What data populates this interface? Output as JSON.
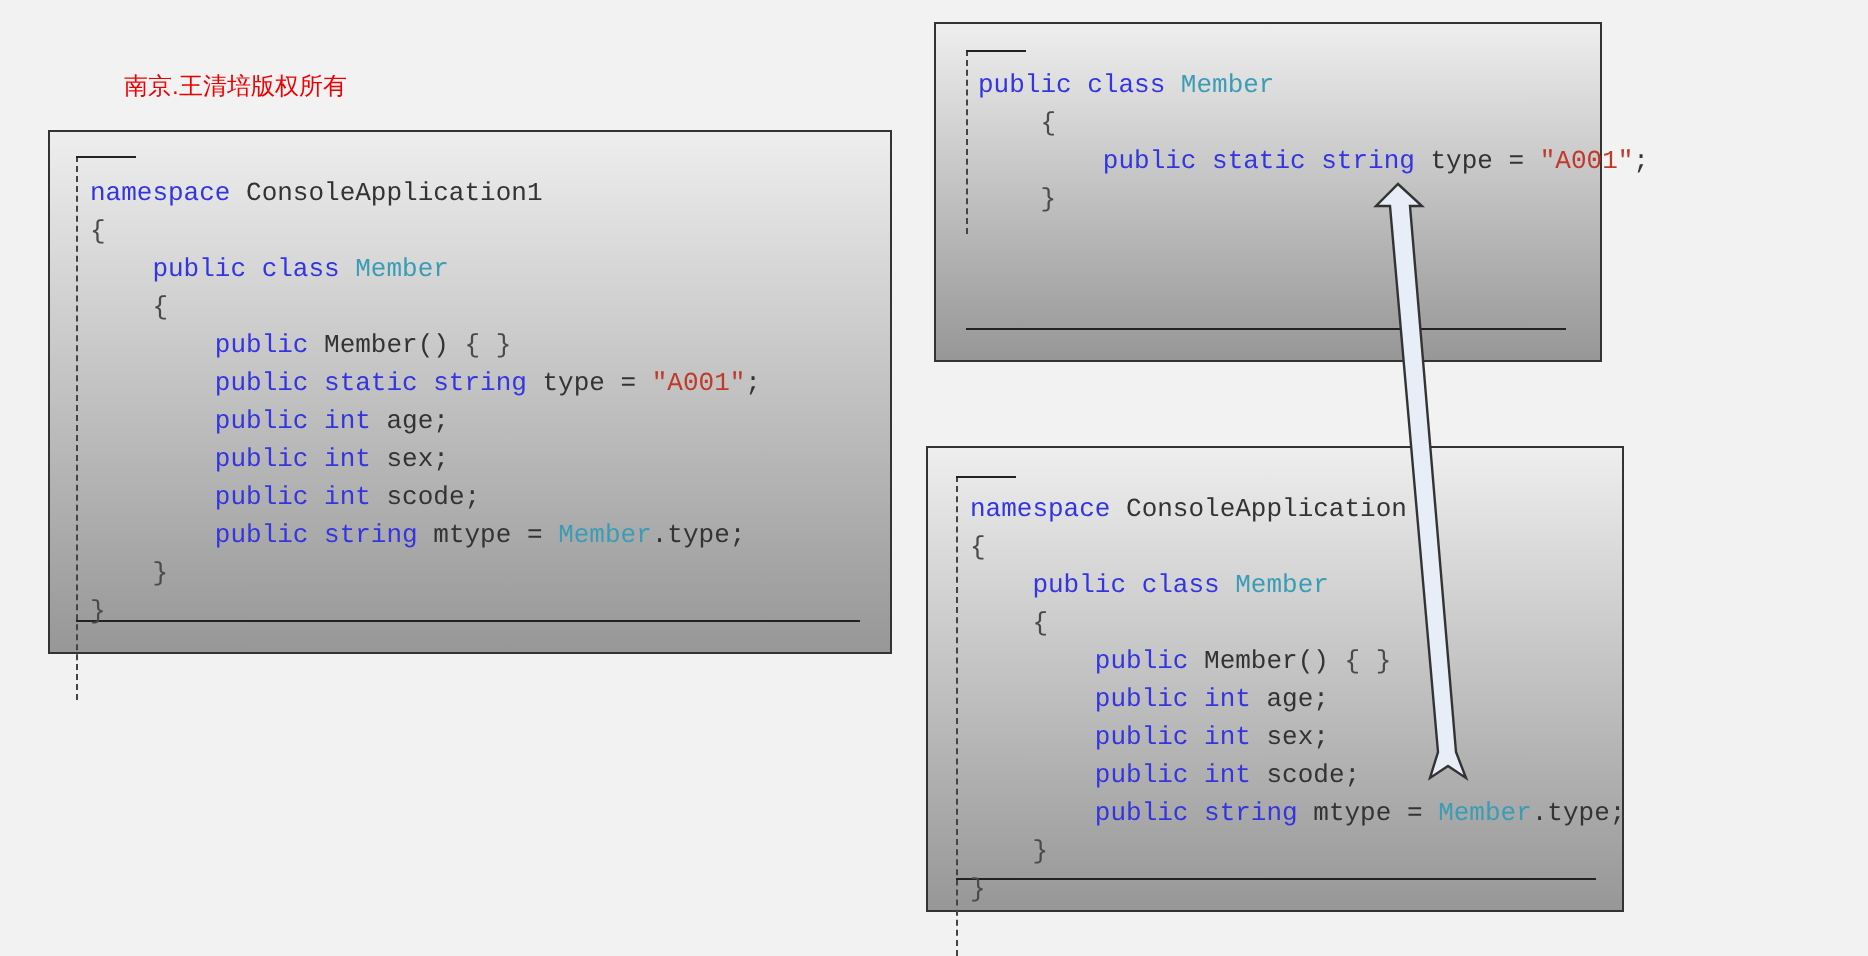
{
  "copyright": "南京.王清培版权所有",
  "panels": [
    {
      "lines": [
        [
          {
            "kind": "keyword",
            "text": "namespace "
          },
          {
            "kind": "plain",
            "text": "ConsoleApplication1"
          }
        ],
        [
          {
            "kind": "punct",
            "text": "{"
          }
        ],
        [
          {
            "kind": "keyword",
            "text": "    public class "
          },
          {
            "kind": "type",
            "text": "Member"
          }
        ],
        [
          {
            "kind": "punct",
            "text": "    {"
          }
        ],
        [
          {
            "kind": "keyword",
            "text": "        public "
          },
          {
            "kind": "plain",
            "text": "Member() "
          },
          {
            "kind": "punct",
            "text": "{ }"
          }
        ],
        [
          {
            "kind": "keyword",
            "text": "        public static string "
          },
          {
            "kind": "plain",
            "text": "type = "
          },
          {
            "kind": "string",
            "text": "\"A001\""
          },
          {
            "kind": "plain",
            "text": ";"
          }
        ],
        [
          {
            "kind": "keyword",
            "text": "        public int "
          },
          {
            "kind": "plain",
            "text": "age;"
          }
        ],
        [
          {
            "kind": "keyword",
            "text": "        public int "
          },
          {
            "kind": "plain",
            "text": "sex;"
          }
        ],
        [
          {
            "kind": "keyword",
            "text": "        public int "
          },
          {
            "kind": "plain",
            "text": "scode;"
          }
        ],
        [
          {
            "kind": "keyword",
            "text": "        public string "
          },
          {
            "kind": "plain",
            "text": "mtype = "
          },
          {
            "kind": "type",
            "text": "Member"
          },
          {
            "kind": "plain",
            "text": ".type;"
          }
        ],
        [
          {
            "kind": "punct",
            "text": "    }"
          }
        ],
        [
          {
            "kind": "punct",
            "text": "}"
          }
        ]
      ]
    },
    {
      "lines": [
        [
          {
            "kind": "keyword",
            "text": "public class "
          },
          {
            "kind": "type",
            "text": "Member"
          }
        ],
        [
          {
            "kind": "punct",
            "text": "    {"
          }
        ],
        [
          {
            "kind": "keyword",
            "text": "        public static string "
          },
          {
            "kind": "plain",
            "text": "type = "
          },
          {
            "kind": "string",
            "text": "\"A001\""
          },
          {
            "kind": "plain",
            "text": ";"
          }
        ],
        [
          {
            "kind": "punct",
            "text": "    }"
          }
        ]
      ]
    },
    {
      "lines": [
        [
          {
            "kind": "keyword",
            "text": "namespace "
          },
          {
            "kind": "plain",
            "text": "ConsoleApplication"
          }
        ],
        [
          {
            "kind": "punct",
            "text": "{"
          }
        ],
        [
          {
            "kind": "keyword",
            "text": "    public class "
          },
          {
            "kind": "type",
            "text": "Member"
          }
        ],
        [
          {
            "kind": "punct",
            "text": "    {"
          }
        ],
        [
          {
            "kind": "keyword",
            "text": "        public "
          },
          {
            "kind": "plain",
            "text": "Member() "
          },
          {
            "kind": "punct",
            "text": "{ }"
          }
        ],
        [
          {
            "kind": "keyword",
            "text": "        public int "
          },
          {
            "kind": "plain",
            "text": "age;"
          }
        ],
        [
          {
            "kind": "keyword",
            "text": "        public int "
          },
          {
            "kind": "plain",
            "text": "sex;"
          }
        ],
        [
          {
            "kind": "keyword",
            "text": "        public int "
          },
          {
            "kind": "plain",
            "text": "scode;"
          }
        ],
        [
          {
            "kind": "keyword",
            "text": "        public string "
          },
          {
            "kind": "plain",
            "text": "mtype = "
          },
          {
            "kind": "type",
            "text": "Member"
          },
          {
            "kind": "plain",
            "text": ".type;"
          }
        ],
        [
          {
            "kind": "punct",
            "text": "    }"
          }
        ],
        [
          {
            "kind": "punct",
            "text": "}"
          }
        ]
      ]
    }
  ]
}
